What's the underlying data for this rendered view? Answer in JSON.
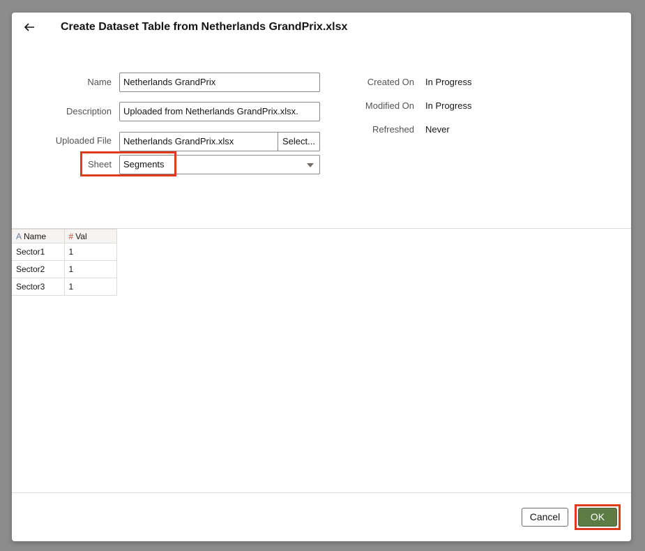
{
  "dialog": {
    "title": "Create Dataset Table from Netherlands GrandPrix.xlsx",
    "back_icon": "arrow-left-icon"
  },
  "form": {
    "name_label": "Name",
    "name_value": "Netherlands GrandPrix",
    "description_label": "Description",
    "description_value": "Uploaded from Netherlands GrandPrix.xlsx.",
    "file_label": "Uploaded File",
    "file_value": "Netherlands GrandPrix.xlsx",
    "select_button": "Select...",
    "sheet_label": "Sheet",
    "sheet_value": "Segments"
  },
  "meta": {
    "created_label": "Created On",
    "created_value": "In Progress",
    "modified_label": "Modified On",
    "modified_value": "In Progress",
    "refreshed_label": "Refreshed",
    "refreshed_value": "Never"
  },
  "preview": {
    "columns": [
      {
        "type_icon": "A",
        "label": "Name"
      },
      {
        "type_icon": "#",
        "label": "Val"
      }
    ],
    "rows": [
      [
        "Sector1",
        "1"
      ],
      [
        "Sector2",
        "1"
      ],
      [
        "Sector3",
        "1"
      ]
    ]
  },
  "footer": {
    "cancel_label": "Cancel",
    "ok_label": "OK"
  },
  "colors": {
    "highlight": "#e03a1e",
    "ok_button": "#5b7c45"
  }
}
